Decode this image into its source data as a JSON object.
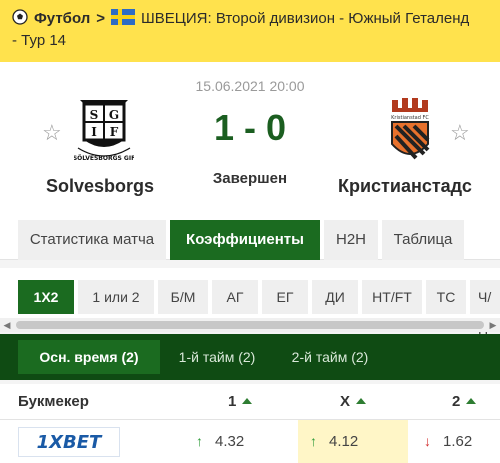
{
  "breadcrumb": {
    "sport": "Футбол",
    "separator": ">",
    "league": "ШВЕЦИЯ: Второй дивизион - Южный Геталенд",
    "round": "- Тур 14"
  },
  "match": {
    "datetime": "15.06.2021 20:00",
    "score": "1 - 0",
    "status": "Завершен",
    "home_team": "Solvesborgs",
    "away_team": "Кристианстадс",
    "home_logo_text": "SÖLVESBORGS GIF",
    "away_logo_text": "Kristianstad FC"
  },
  "main_tabs": [
    {
      "label": "Статистика матча",
      "active": false
    },
    {
      "label": "Коэффициенты",
      "active": true
    },
    {
      "label": "H2H",
      "active": false
    },
    {
      "label": "Таблица",
      "active": false
    }
  ],
  "markets": [
    {
      "label": "1X2",
      "active": true
    },
    {
      "label": "1 или 2",
      "active": false
    },
    {
      "label": "Б/М",
      "active": false
    },
    {
      "label": "АГ",
      "active": false
    },
    {
      "label": "ЕГ",
      "active": false
    },
    {
      "label": "ДИ",
      "active": false
    },
    {
      "label": "HT/FT",
      "active": false
    },
    {
      "label": "ТС",
      "active": false
    },
    {
      "label": "Ч/Н",
      "active": false
    }
  ],
  "periods": [
    {
      "label": "Осн. время (2)",
      "active": true
    },
    {
      "label": "1-й тайм (2)",
      "active": false
    },
    {
      "label": "2-й тайм (2)",
      "active": false
    }
  ],
  "odds_table": {
    "bookmaker_header": "Букмекер",
    "col1": "1",
    "colx": "X",
    "col2": "2",
    "rows": [
      {
        "bookmaker": "1XBET",
        "odd1": "4.32",
        "odd1_trend": "up",
        "oddx": "4.12",
        "oddx_trend": "up",
        "odd2": "1.62",
        "odd2_trend": "down"
      }
    ]
  },
  "colors": {
    "accent_green": "#1b6b20",
    "header_yellow": "#ffe24d",
    "trend_up": "#2e9b3a",
    "trend_down": "#d32f2f"
  }
}
